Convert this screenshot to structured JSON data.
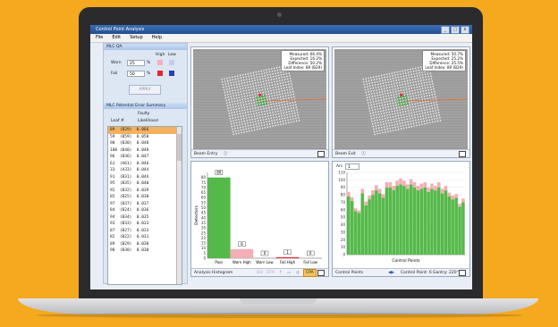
{
  "app": {
    "title": "Control Point Analysis",
    "menu": [
      "File",
      "Edit",
      "Setup",
      "Help"
    ]
  },
  "mlc_qa": {
    "title": "MLC QA",
    "high_label": "High",
    "low_label": "Low",
    "warn_label": "Warn",
    "warn_value": "25",
    "fail_label": "Fail",
    "fail_value": "50",
    "percent": "%",
    "apply_label": "APPLY",
    "colors": {
      "warn_high": "#f3b0b8",
      "warn_low": "#c4ccf4",
      "fail_high": "#e4262a",
      "fail_low": "#2740b8"
    }
  },
  "error_summary": {
    "title": "MLC Potential Error Summary",
    "col_leaf": "Leaf #",
    "col_faulty": "Faulty",
    "col_likelihood": "Likelihood",
    "rows": [
      "89  (B29)  0.066",
      "59  (B59)  0.050",
      "90  (B30)  0.048",
      "100 (B40)  0.048",
      "96  (B36)  0.047",
      "61  (A61)  0.046",
      "33  (A33)  0.044",
      "91  (B31)  0.044",
      "95  (B35)  0.040",
      "92  (B32)  0.039",
      "85  (B25)  0.038",
      "97  (B37)  0.037",
      "84  (B24)  0.036",
      "94  (B34)  0.035",
      "93  (B33)  0.033",
      "87  (B27)  0.033",
      "82  (B22)  0.031",
      "89  (B29)  0.030",
      "98  (B38)  0.030"
    ]
  },
  "beam_entry": {
    "label": "Beam Entry",
    "info": [
      "Measured: 66.4%",
      "Expected: 16.2%",
      "Difference: 50.2%",
      "Leaf Index: 89 (B29)"
    ]
  },
  "beam_exit": {
    "label": "Beam Exit",
    "info": [
      "Measured: 50.7%",
      "Expected: 25.2%",
      "Difference: 25.5%",
      "Leaf Index: 89 (B29)"
    ]
  },
  "histogram": {
    "footer_label": "Analysis Histogram",
    "y_label": "Detectors",
    "cpa_label": "CPA",
    "dd_label": "DD",
    "dta_label": "DTA"
  },
  "control_points": {
    "arc_label": "Arc",
    "arc_value": "1",
    "x_label": "Control Points",
    "footer_label": "Control Points",
    "status_cp": "Control Point: 6",
    "status_gantry": "Gantry: 220°"
  },
  "chart_data": [
    {
      "type": "bar",
      "categories": [
        "Pass",
        "Warn High",
        "Warn Low",
        "Fail High",
        "Fail Low"
      ],
      "values": [
        80,
        9,
        0,
        1,
        0
      ],
      "data_labels": [
        "80",
        "9",
        "0",
        "1",
        "0"
      ],
      "ylabel": "Detectors",
      "ylim": [
        0,
        85
      ],
      "yticks": [
        0,
        5,
        10,
        15,
        20,
        25,
        30,
        35,
        40,
        45,
        50,
        55,
        60,
        65,
        70,
        75,
        80
      ],
      "colors": [
        "#55b94a",
        "#f2aeb4",
        "#c4ccf4",
        "#e4262a",
        "#2740b8"
      ]
    },
    {
      "type": "bar",
      "title": "",
      "xlabel": "Control Points",
      "ylim": [
        0,
        110
      ],
      "yticks": [
        0,
        10,
        20,
        30,
        40,
        50,
        60,
        70,
        80,
        90,
        100,
        110
      ],
      "series": [
        {
          "values": [
            78,
            72,
            58,
            56,
            82,
            66,
            74,
            80,
            86,
            82,
            76,
            90,
            90,
            86,
            92,
            94,
            92,
            88,
            94,
            90,
            86,
            88,
            90,
            84,
            88,
            86,
            90,
            82,
            86,
            78,
            74,
            76,
            64,
            70
          ]
        },
        {
          "values": [
            6,
            5,
            4,
            3,
            6,
            5,
            5,
            6,
            7,
            6,
            5,
            7,
            7,
            6,
            7,
            8,
            7,
            6,
            7,
            7,
            6,
            7,
            7,
            6,
            7,
            6,
            7,
            6,
            6,
            5,
            5,
            5,
            4,
            5
          ]
        }
      ],
      "colors": [
        "#55b94a",
        "#f2aeb4"
      ]
    }
  ]
}
